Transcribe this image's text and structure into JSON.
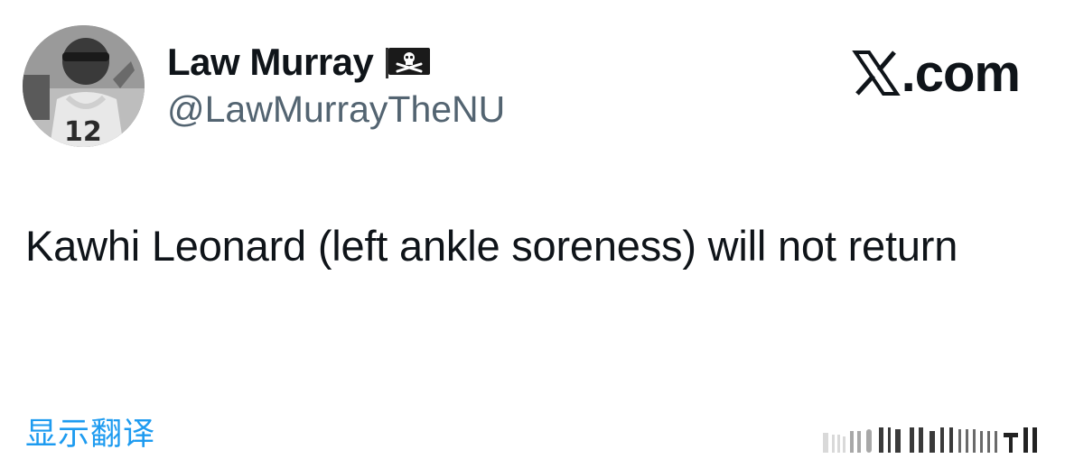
{
  "author": {
    "display_name": "Law Murray",
    "handle": "@LawMurrayTheNU",
    "badge_icon": "pirate-flag-icon",
    "avatar_icon": "profile-avatar"
  },
  "brand": {
    "x_mark": "x-logo-icon",
    "domain_suffix": ".com"
  },
  "tweet": {
    "text": "Kawhi Leonard (left ankle soreness) will not return"
  },
  "actions": {
    "translate_label": "显示翻译"
  },
  "colors": {
    "text_primary": "#0f1419",
    "text_secondary": "#536471",
    "link": "#1d9bf0",
    "background": "#ffffff"
  }
}
